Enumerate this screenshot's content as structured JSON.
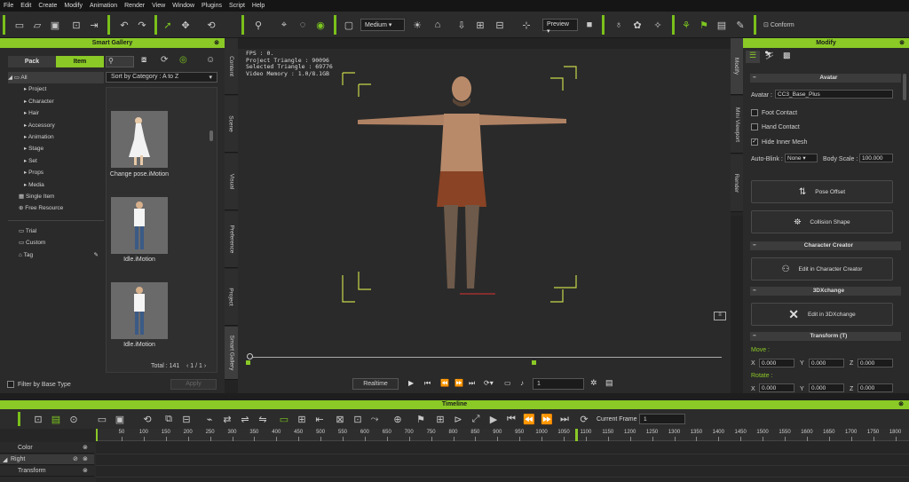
{
  "menu": [
    "File",
    "Edit",
    "Create",
    "Modify",
    "Animation",
    "Render",
    "View",
    "Window",
    "Plugins",
    "Script",
    "Help"
  ],
  "toolbar": {
    "quality": "Medium",
    "render_mode": "Preview",
    "conform": "Conform"
  },
  "gallery": {
    "title": "Smart Gallery",
    "tabs": [
      "Pack",
      "Item"
    ],
    "sort": "Sort by Category : A to Z",
    "tree_all": "All",
    "tree": [
      "Project",
      "Character",
      "Hair",
      "Accessory",
      "Animation",
      "Stage",
      "Set",
      "Props",
      "Media"
    ],
    "tree_extra": [
      "Single Item",
      "Free Resource"
    ],
    "tree_tags": [
      "Trial",
      "Custom",
      "Tag"
    ],
    "items": [
      "Change pose.iMotion",
      "Idle.iMotion",
      "Idle.iMotion"
    ],
    "total": "Total : 141",
    "page": "1",
    "page_sep": "/",
    "pages": "1",
    "filter": "Filter by Base Type",
    "apply": "Apply"
  },
  "side_tabs": [
    "Content",
    "Scene",
    "Visual",
    "Preference",
    "Project",
    "Smart Gallery"
  ],
  "right_tabs": [
    "Modify",
    "Mini Viewport",
    "Render"
  ],
  "viewport": {
    "fps": "FPS : 0.",
    "project_tri": "Project Triangle : 90096",
    "selected_tri": "Selected Triangle : 69776",
    "video_mem": "Video Memory : 1.0/8.1GB"
  },
  "playback": {
    "mode": "Realtime",
    "frame": "1"
  },
  "modify": {
    "title": "Modify",
    "avatar_section": "Avatar",
    "avatar_label": "Avatar :",
    "avatar_value": "CC3_Base_Plus",
    "foot_contact": "Foot Contact",
    "hand_contact": "Hand Contact",
    "hide_mesh": "Hide Inner Mesh",
    "auto_blink_label": "Auto-Blink :",
    "auto_blink": "None",
    "body_scale_label": "Body Scale :",
    "body_scale": "100.000",
    "pose_offset": "Pose Offset",
    "collision": "Collision Shape",
    "cc_section": "Character Creator",
    "edit_cc": "Edit in Character Creator",
    "x_section": "3DXchange",
    "edit_x": "Edit in 3DXchange",
    "transform_section": "Transform  (T)",
    "move": "Move :",
    "rotate": "Rotate :",
    "x": "X",
    "y": "Y",
    "z": "Z",
    "val": "0.000"
  },
  "timeline": {
    "title": "Timeline",
    "current_frame_label": "Current Frame :",
    "current_frame": "1",
    "tracks": [
      "Color",
      "Right",
      "Transform"
    ],
    "ticks": [
      "50",
      "100",
      "150",
      "200",
      "250",
      "300",
      "350",
      "400",
      "450",
      "500",
      "550",
      "600",
      "650",
      "700",
      "750",
      "800",
      "850",
      "900",
      "950",
      "1000",
      "1050",
      "1100",
      "1150",
      "1200",
      "1250",
      "1300",
      "1350",
      "1400",
      "1450",
      "1500",
      "1550",
      "1600",
      "1650",
      "1700",
      "1750",
      "1800"
    ]
  },
  "colors": {
    "accent": "#8ac926",
    "bg": "#2a2a2a"
  }
}
